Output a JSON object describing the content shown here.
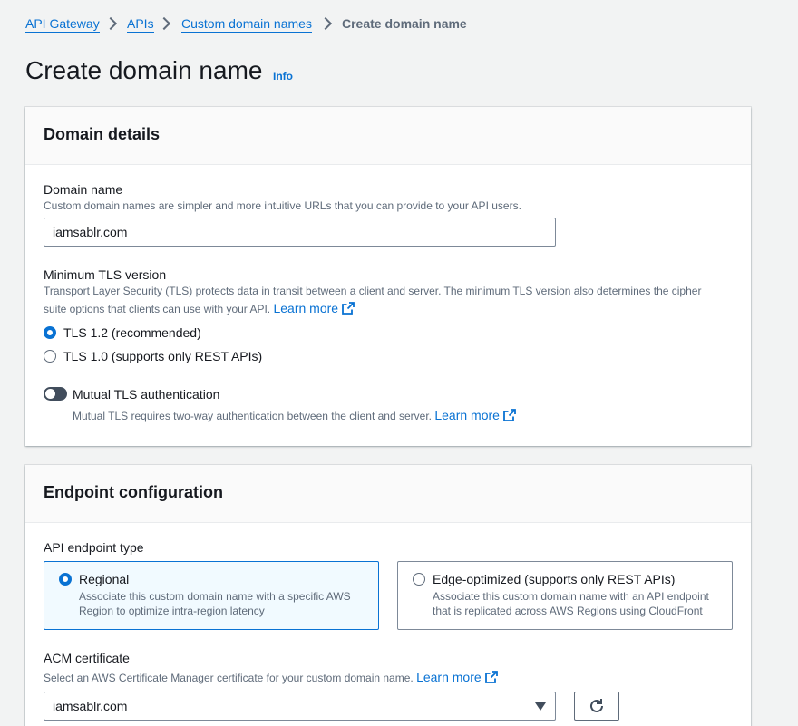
{
  "breadcrumb": {
    "items": [
      "API Gateway",
      "APIs",
      "Custom domain names"
    ],
    "current": "Create domain name"
  },
  "page": {
    "title": "Create domain name",
    "info_label": "Info"
  },
  "domain_details": {
    "title": "Domain details",
    "domain_name": {
      "label": "Domain name",
      "description": "Custom domain names are simpler and more intuitive URLs that you can provide to your API users.",
      "value": "iamsablr.com"
    },
    "tls": {
      "label": "Minimum TLS version",
      "description": "Transport Layer Security (TLS) protects data in transit between a client and server. The minimum TLS version also determines the cipher suite options that clients can use with your API.",
      "learn_more": "Learn more",
      "options": [
        "TLS 1.2 (recommended)",
        "TLS 1.0 (supports only REST APIs)"
      ],
      "selected": "TLS 1.2 (recommended)"
    },
    "mutual_tls": {
      "label": "Mutual TLS authentication",
      "description": "Mutual TLS requires two-way authentication between the client and server.",
      "learn_more": "Learn more",
      "enabled": false
    }
  },
  "endpoint_config": {
    "title": "Endpoint configuration",
    "endpoint_type": {
      "label": "API endpoint type",
      "options": [
        {
          "title": "Regional",
          "description": "Associate this custom domain name with a specific AWS Region to optimize intra-region latency",
          "selected": true
        },
        {
          "title": "Edge-optimized (supports only REST APIs)",
          "description": "Associate this custom domain name with an API endpoint that is replicated across AWS Regions using CloudFront",
          "selected": false
        }
      ]
    },
    "acm": {
      "label": "ACM certificate",
      "description": "Select an AWS Certificate Manager certificate for your custom domain name.",
      "learn_more": "Learn more",
      "value": "iamsablr.com"
    }
  },
  "colors": {
    "link": "#0972d3",
    "text": "#16191f",
    "muted": "#5f6b7a",
    "selected_bg": "#f1faff"
  }
}
